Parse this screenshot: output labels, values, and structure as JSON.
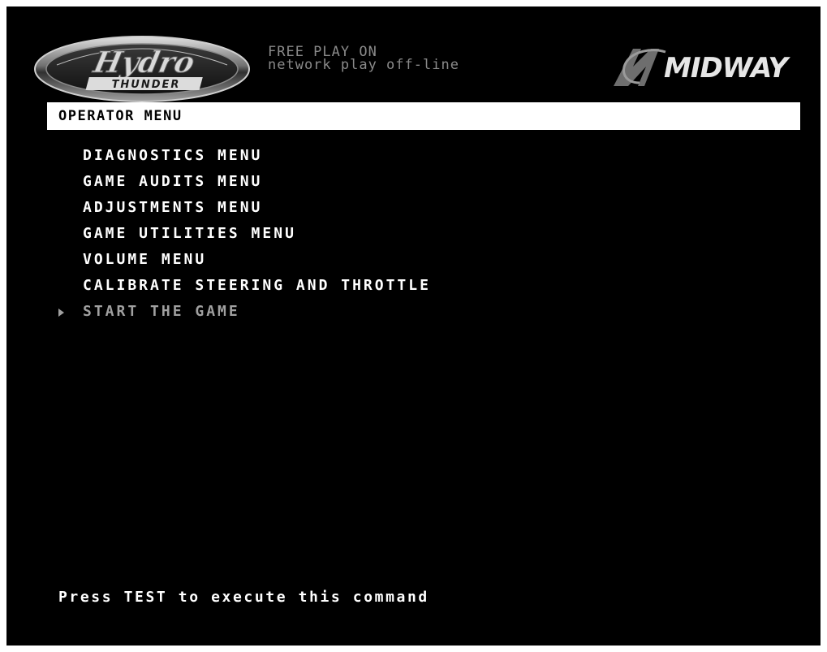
{
  "header": {
    "game_logo": {
      "icon": "hydro-thunder-logo",
      "text": "Hydro THUNDER"
    },
    "status_line_1": "FREE PLAY ON",
    "status_line_2": "network play off-line",
    "brand_logo": {
      "icon": "midway-logo",
      "text": "MIDWAY"
    }
  },
  "menu": {
    "title": "OPERATOR MENU",
    "items": [
      {
        "label": "DIAGNOSTICS MENU",
        "selected": false
      },
      {
        "label": "GAME AUDITS MENU",
        "selected": false
      },
      {
        "label": "ADJUSTMENTS MENU",
        "selected": false
      },
      {
        "label": "GAME UTILITIES MENU",
        "selected": false
      },
      {
        "label": "VOLUME MENU",
        "selected": false
      },
      {
        "label": "CALIBRATE STEERING AND THROTTLE",
        "selected": false
      },
      {
        "label": "START THE GAME",
        "selected": true
      }
    ],
    "cursor_icon": "triangle-right-icon"
  },
  "footer": {
    "hint": "Press TEST to execute this command"
  },
  "colors": {
    "background": "#000000",
    "text": "#ffffff",
    "selected_text": "#a0a0a0",
    "status_text": "#8a8a8a",
    "title_bar": "#ffffff"
  }
}
